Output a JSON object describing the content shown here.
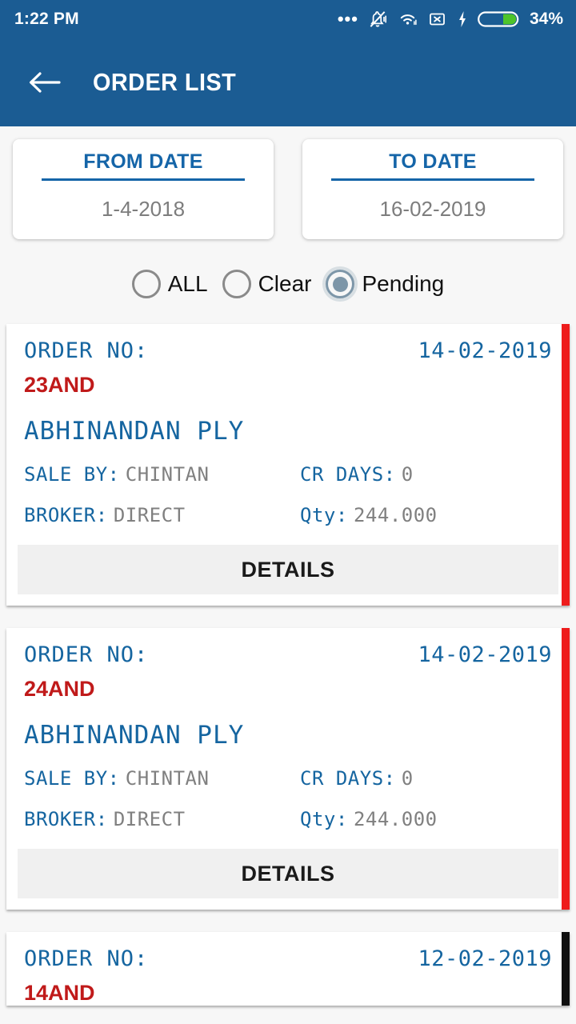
{
  "statusbar": {
    "time": "1:22 PM",
    "dots": "•••",
    "battery_percent": "34%",
    "icons": [
      "more-dots-icon",
      "vibrate-bell-icon",
      "wifi-icon",
      "sim-x-icon",
      "charging-bolt-icon",
      "battery-icon"
    ],
    "battery_fill_color": "#4ec42a",
    "bar_color": "#1b5c93"
  },
  "appbar": {
    "title": "ORDER LIST",
    "back_icon": "back-arrow-icon",
    "color": "#1b5c93"
  },
  "filters": {
    "from_date": {
      "label": "FROM DATE",
      "value": "1-4-2018"
    },
    "to_date": {
      "label": "TO DATE",
      "value": "16-02-2019"
    },
    "radios": [
      {
        "label": "ALL",
        "selected": false
      },
      {
        "label": "Clear",
        "selected": false
      },
      {
        "label": "Pending",
        "selected": true
      }
    ],
    "selected_radio": "Pending",
    "accent_color": "#1565a8",
    "radio_selected_color": "#7d96a8"
  },
  "labels": {
    "order_no": "ORDER NO:",
    "sale_by": "SALE BY:",
    "cr_days": "CR DAYS:",
    "broker": "BROKER:",
    "qty": "Qty:",
    "details": "DETAILS"
  },
  "orders": [
    {
      "order_no": "23AND",
      "date": "14-02-2019",
      "party": "ABHINANDAN PLY",
      "sale_by": "CHINTAN",
      "cr_days": "0",
      "broker": "DIRECT",
      "qty": "244.000",
      "status_color": "#ee1c1c"
    },
    {
      "order_no": "24AND",
      "date": "14-02-2019",
      "party": "ABHINANDAN PLY",
      "sale_by": "CHINTAN",
      "cr_days": "0",
      "broker": "DIRECT",
      "qty": "244.000",
      "status_color": "#ee1c1c"
    },
    {
      "order_no": "14AND",
      "date": "12-02-2019",
      "party": "",
      "sale_by": "",
      "cr_days": "",
      "broker": "",
      "qty": "",
      "status_color": "#101010"
    }
  ]
}
